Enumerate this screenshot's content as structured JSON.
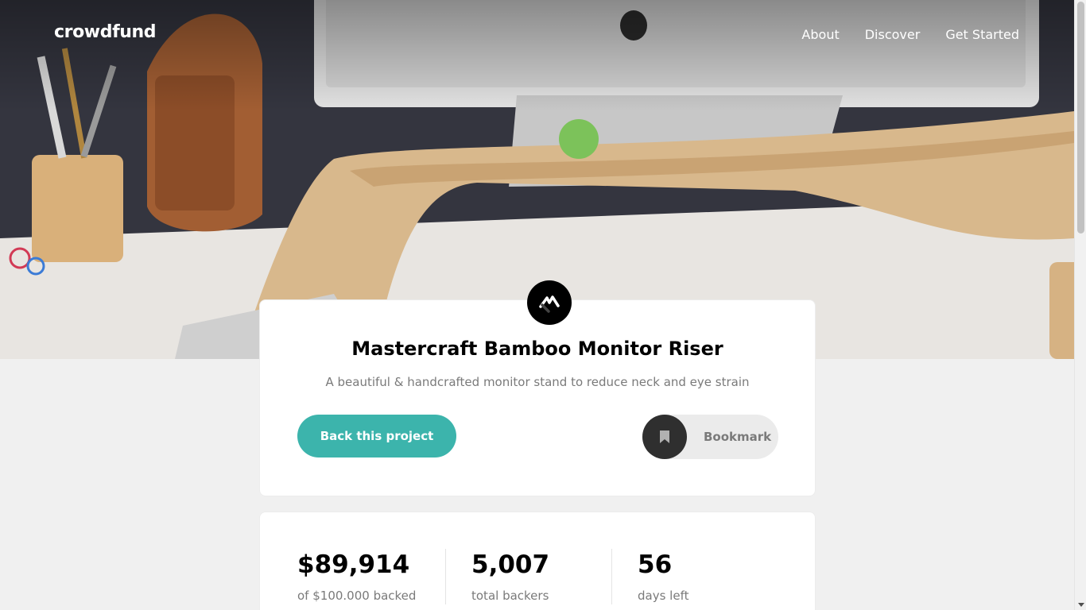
{
  "nav": {
    "logo": "crowdfund",
    "links": [
      {
        "label": "About"
      },
      {
        "label": "Discover"
      },
      {
        "label": "Get Started"
      }
    ]
  },
  "project": {
    "title": "Mastercraft Bamboo Monitor Riser",
    "description": "A beautiful & handcrafted monitor stand to reduce neck and eye strain",
    "back_label": "Back this project",
    "bookmark_label": "Bookmark"
  },
  "stats": [
    {
      "value": "$89,914",
      "label": "of $100.000 backed"
    },
    {
      "value": "5,007",
      "label": "total backers"
    },
    {
      "value": "56",
      "label": "days left"
    }
  ],
  "colors": {
    "accent": "#3cb4ac",
    "bookmark_icon_bg": "#2f2f2f",
    "page_bg": "#f0f0f0"
  },
  "icons": {
    "project_logo": "mastercraft-logo-icon",
    "bookmark": "bookmark-icon"
  }
}
